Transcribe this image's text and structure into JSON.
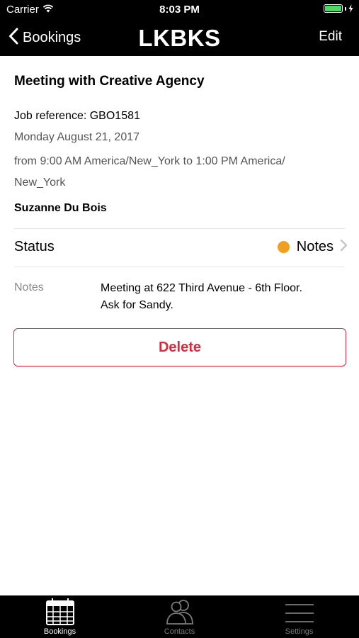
{
  "status_bar": {
    "carrier": "Carrier",
    "time": "8:03 PM",
    "battery_level": 1.0,
    "battery_color": "#4cd964"
  },
  "nav": {
    "back_label": "Bookings",
    "brand": "LKBKS",
    "edit_label": "Edit"
  },
  "booking": {
    "title": "Meeting with Creative Agency",
    "job_reference": "Job reference: GBO1581",
    "date": "Monday August 21, 2017",
    "time_range": "from 9:00 AM America/New_York to 1:00 PM America/ New_York",
    "person": "Suzanne Du Bois",
    "status_label": "Status",
    "status_value": "Notes",
    "status_color": "#f0a01e",
    "notes_label": "Notes",
    "notes_text": "Meeting at 622 Third Avenue - 6th Floor.  Ask for Sandy.",
    "delete_label": "Delete",
    "delete_color": "#e0263a"
  },
  "tabs": [
    {
      "label": "Bookings",
      "icon": "calendar-icon",
      "active": true
    },
    {
      "label": "Contacts",
      "icon": "contacts-icon",
      "active": false
    },
    {
      "label": "Settings",
      "icon": "settings-icon",
      "active": false
    }
  ]
}
